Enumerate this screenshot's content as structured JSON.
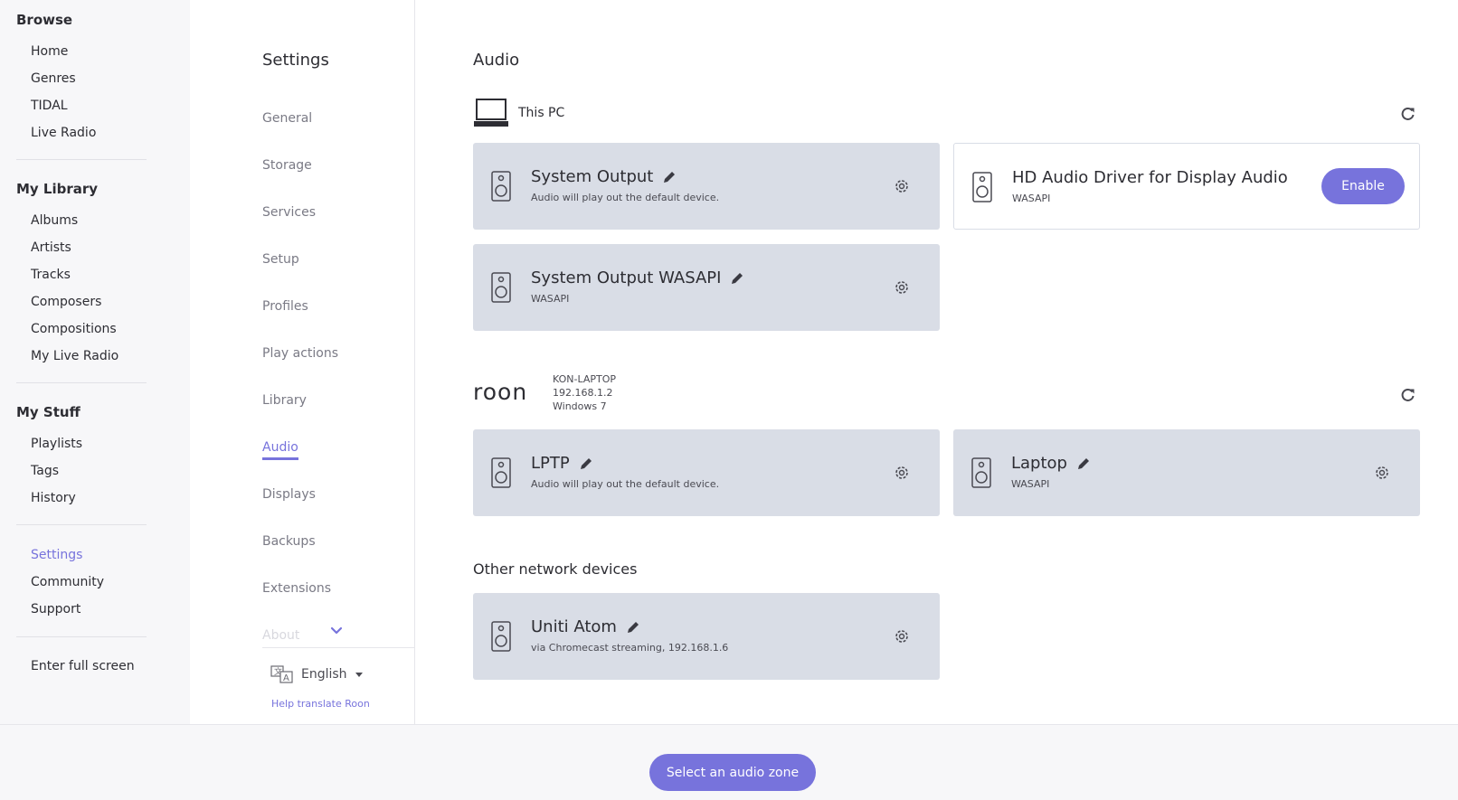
{
  "sidebar": {
    "browse_title": "Browse",
    "browse_items": [
      {
        "label": "Home"
      },
      {
        "label": "Genres"
      },
      {
        "label": "TIDAL"
      },
      {
        "label": "Live Radio"
      }
    ],
    "library_title": "My Library",
    "library_items": [
      {
        "label": "Albums"
      },
      {
        "label": "Artists"
      },
      {
        "label": "Tracks"
      },
      {
        "label": "Composers"
      },
      {
        "label": "Compositions"
      },
      {
        "label": "My Live Radio"
      }
    ],
    "stuff_title": "My Stuff",
    "stuff_items": [
      {
        "label": "Playlists"
      },
      {
        "label": "Tags"
      },
      {
        "label": "History"
      }
    ],
    "system_items": [
      {
        "label": "Settings",
        "active": true
      },
      {
        "label": "Community"
      },
      {
        "label": "Support"
      }
    ],
    "fullscreen_label": "Enter full screen"
  },
  "settings_nav": {
    "title": "Settings",
    "items": [
      {
        "label": "General"
      },
      {
        "label": "Storage"
      },
      {
        "label": "Services"
      },
      {
        "label": "Setup"
      },
      {
        "label": "Profiles"
      },
      {
        "label": "Play actions"
      },
      {
        "label": "Library"
      },
      {
        "label": "Audio",
        "active": true
      },
      {
        "label": "Displays"
      },
      {
        "label": "Backups"
      },
      {
        "label": "Extensions"
      },
      {
        "label": "About"
      }
    ],
    "language": "English",
    "help_link": "Help translate Roon"
  },
  "main": {
    "title": "Audio",
    "this_pc": {
      "label": "This PC",
      "devices": [
        {
          "name": "System Output",
          "sub": "Audio will play out the default device.",
          "enabled": true
        },
        {
          "name": "HD Audio Driver for Display Audio",
          "sub": "WASAPI",
          "enabled": false,
          "button": "Enable"
        },
        {
          "name": "System Output WASAPI",
          "sub": "WASAPI",
          "enabled": true
        }
      ]
    },
    "remote_host": {
      "logo": "roon",
      "name": "KON-LAPTOP",
      "ip": "192.168.1.2",
      "os": "Windows 7",
      "devices": [
        {
          "name": "LPTP",
          "sub": "Audio will play out the default device.",
          "enabled": true
        },
        {
          "name": "Laptop",
          "sub": "WASAPI",
          "enabled": true
        }
      ]
    },
    "other_network": {
      "label": "Other network devices",
      "devices": [
        {
          "name": "Uniti Atom",
          "sub": "via Chromecast streaming, 192.168.1.6",
          "enabled": true
        }
      ]
    }
  },
  "footer": {
    "zone_button": "Select an audio zone"
  },
  "colors": {
    "accent": "#7773dc",
    "card_bg": "#d9dde6",
    "sidebar_bg": "#f7f7f9"
  }
}
